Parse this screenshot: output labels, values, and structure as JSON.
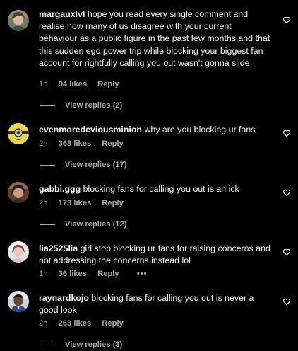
{
  "comments": [
    {
      "username": "margauxlvl",
      "text": "hope you read every single comment and realise how many of us disagree with your current behaviour as a public figure in the past few months and that this sudden ego power trip while blocking your biggest fan account for rightfully calling you out wasn't gonna slide",
      "time": "1h",
      "likes": "94 likes",
      "reply": "Reply",
      "view_replies": "View replies (2)"
    },
    {
      "username": "evenmoredeviousminion",
      "text": "why are you blocking ur fans",
      "time": "2h",
      "likes": "368 likes",
      "reply": "Reply",
      "view_replies": "View replies (17)"
    },
    {
      "username": "gabbi.ggg",
      "text": "blocking fans for calling you out is an ick",
      "time": "2h",
      "likes": "173 likes",
      "reply": "Reply",
      "view_replies": "View replies (12)"
    },
    {
      "username": "lia2525lia",
      "text": "girl stop blocking ur fans for raising concerns and not addressing the concerns instead lol",
      "time": "1h",
      "likes": "36 likes",
      "reply": "Reply",
      "more": "•••"
    },
    {
      "username": "raynardkojo",
      "text": "blocking fans for calling you out is never a good look",
      "time": "2h",
      "likes": "263 likes",
      "reply": "Reply",
      "view_replies": "View replies (3)"
    }
  ],
  "colors": {
    "background": "#000000",
    "text": "#f5f5f5",
    "secondary": "#a8a8a8"
  },
  "icons": {
    "like": "heart-outline-icon",
    "more": "more-options-icon",
    "avatar": "user-avatar"
  }
}
